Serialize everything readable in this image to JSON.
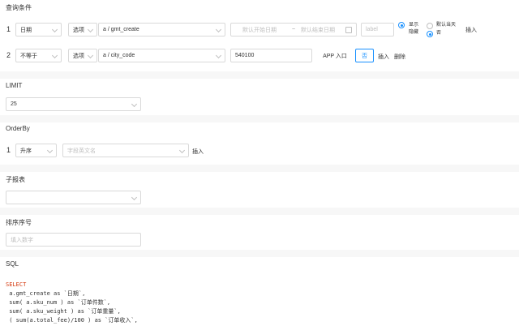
{
  "conditions": {
    "title": "查询条件",
    "rows": [
      {
        "index": "1",
        "field": "日期",
        "option": "选项",
        "column": "a / gmt_create",
        "start_placeholder": "默认开始日期",
        "range_sep": "~",
        "end_placeholder": "默认结束日期",
        "label_placeholder": "label",
        "radio_show": "显示",
        "radio_hide": "隐藏",
        "radio_default_day_a": "默认当天",
        "radio_default_day_b": "否",
        "insert": "插入"
      },
      {
        "index": "2",
        "operator": "不等于",
        "option": "选项",
        "column": "a / city_code",
        "value": "540100",
        "app_entry": "APP 入口",
        "no_button": "否",
        "insert": "插入",
        "delete": "删除"
      }
    ]
  },
  "limit": {
    "title": "LIMIT",
    "value": "25"
  },
  "orderby": {
    "title": "OrderBy",
    "index": "1",
    "direction": "升序",
    "field_placeholder": "字段英文名",
    "insert": "插入"
  },
  "subreport": {
    "title": "子报表",
    "value": ""
  },
  "sort_order": {
    "title": "排序序号",
    "placeholder": "填入数字"
  },
  "sql": {
    "title": "SQL",
    "lines": [
      "SELECT",
      " a.gmt_create as `日期`,",
      " sum( a.sku_num ) as `订单件数`,",
      " sum( a.sku_weight ) as `订单重量`,",
      " ( sum(a.total_fee)/100 ) as `订单收入`,"
    ]
  },
  "colors": {
    "accent": "#1890ff",
    "keyword": "#d4380d",
    "string": "#c41d7f"
  },
  "icons": {
    "select": "chevron-down-icon",
    "date": "calendar-icon"
  }
}
